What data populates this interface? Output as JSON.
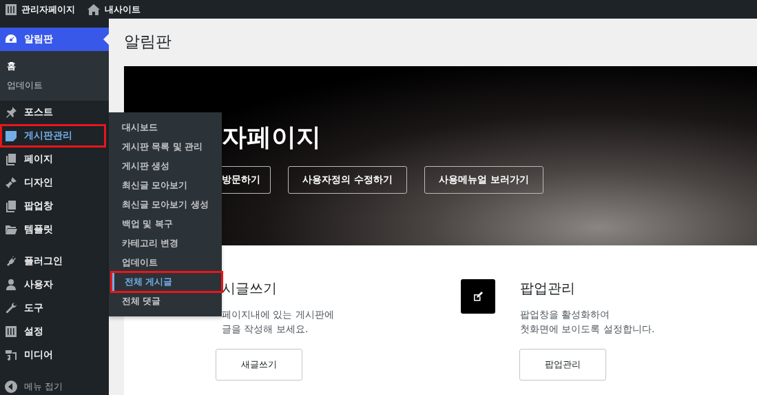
{
  "top_bar": {
    "site_menu": "관리자페이지",
    "home_link": "내사이트"
  },
  "sidebar": {
    "groups": [
      {
        "items": [
          {
            "label": "알림판",
            "selected": true,
            "hovered": false,
            "highlighted": false,
            "submenu": [
              {
                "label": "홈",
                "selected": true
              },
              {
                "label": "업데이트",
                "selected": false
              }
            ]
          },
          {
            "label": "포스트",
            "selected": false,
            "hovered": false,
            "highlighted": false
          },
          {
            "label": "게시판관리",
            "selected": false,
            "hovered": true,
            "highlighted": true,
            "flyout": [
              {
                "label": "대시보드",
                "selected": false,
                "highlighted": false
              },
              {
                "label": "게시판 목록 및 관리",
                "selected": false,
                "highlighted": false
              },
              {
                "label": "게시판 생성",
                "selected": false,
                "highlighted": false
              },
              {
                "label": "최신글 모아보기",
                "selected": false,
                "highlighted": false
              },
              {
                "label": "최신글 모아보기 생성",
                "selected": false,
                "highlighted": false
              },
              {
                "label": "백업 및 복구",
                "selected": false,
                "highlighted": false
              },
              {
                "label": "카테고리 변경",
                "selected": false,
                "highlighted": false
              },
              {
                "label": "업데이트",
                "selected": false,
                "highlighted": false
              },
              {
                "label": "전체 게시글",
                "selected": true,
                "highlighted": true
              },
              {
                "label": "전체 댓글",
                "selected": false,
                "highlighted": false
              }
            ]
          },
          {
            "label": "페이지",
            "selected": false,
            "hovered": false,
            "highlighted": false
          },
          {
            "label": "디자인",
            "selected": false,
            "hovered": false,
            "highlighted": false
          },
          {
            "label": "팝업창",
            "selected": false,
            "hovered": false,
            "highlighted": false
          },
          {
            "label": "템플릿",
            "selected": false,
            "hovered": false,
            "highlighted": false
          }
        ]
      },
      {
        "items": [
          {
            "label": "플러그인",
            "selected": false,
            "hovered": false,
            "highlighted": false
          },
          {
            "label": "사용자",
            "selected": false,
            "hovered": false,
            "highlighted": false
          },
          {
            "label": "도구",
            "selected": false,
            "hovered": false,
            "highlighted": false
          },
          {
            "label": "설정",
            "selected": false,
            "hovered": false,
            "highlighted": false
          },
          {
            "label": "미디어",
            "selected": false,
            "hovered": false,
            "highlighted": false
          }
        ]
      }
    ],
    "collapse": "메뉴 접기"
  },
  "page_title": "알림판",
  "hero": {
    "title": "자페이지",
    "buttons": [
      "방문하기",
      "사용자정의 수정하기",
      "사용메뉴얼 보러가기"
    ]
  },
  "cards": [
    {
      "title": "시글쓰기",
      "description": [
        "페이지내에 있는 게시판에",
        "글을 작성해 보세요."
      ],
      "button": "새글쓰기",
      "has_icon": false
    },
    {
      "title": "팝업관리",
      "description": [
        "팝업창을 활성화하여",
        "첫화면에 보이도록 설정합니다."
      ],
      "button": "팝업관리",
      "has_icon": true
    }
  ]
}
